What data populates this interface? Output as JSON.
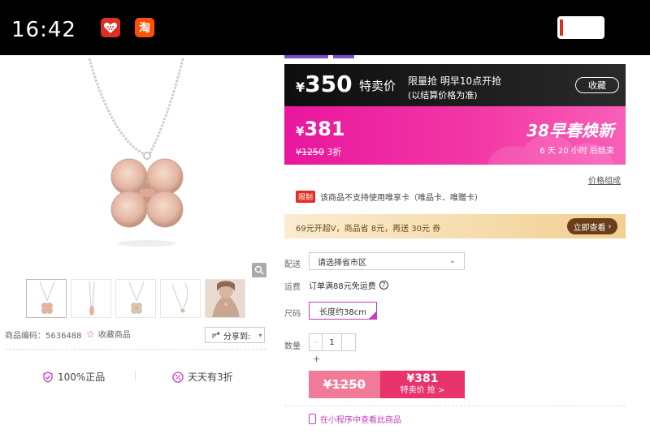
{
  "status_bar": {
    "time": "16:42",
    "apps": [
      {
        "name": "pinduoduo",
        "glyph": "",
        "color": "#e02e24"
      },
      {
        "name": "taobao",
        "glyph": "淘",
        "color": "#ff5000"
      }
    ],
    "battery_level": 0.08
  },
  "product_gallery": {
    "thumbnail_count": 5,
    "item_code": "商品编码：5636488",
    "favorite_label": "收藏商品",
    "share_label": "分享到:"
  },
  "guarantees": [
    {
      "label": "100%正品",
      "icon": "shield-check-icon"
    },
    {
      "label": "天天有3折",
      "icon": "discount-icon"
    }
  ],
  "flash_sale": {
    "price": "350",
    "currency": "¥",
    "label": "特卖价",
    "info_line1": "限量抢  明早10点开抢",
    "info_line2": "(以结算价格为准)",
    "collect_label": "收藏"
  },
  "promo": {
    "currency": "¥",
    "price": "381",
    "original_price": "¥1250",
    "discount": "3折",
    "event_title": "38早春焕新",
    "countdown": "6 天 20 小时 后结束"
  },
  "price_detail_link": "价格组成",
  "limit_notice": {
    "badge": "限制",
    "text": "该商品不支持使用唯享卡（唯品卡、唯赠卡）"
  },
  "vip_banner": {
    "text": "69元开超V，商品省 8元，再送 30元 券",
    "button_label": "立即查看"
  },
  "options": {
    "delivery_label": "配送",
    "delivery_placeholder": "请选择省市区",
    "shipping_label": "运费",
    "shipping_text": "订单满88元免运费",
    "size_label": "尺码",
    "size_value": "长度约38cm",
    "quantity_label": "数量",
    "quantity_value": "1",
    "minus": "-",
    "plus": "+"
  },
  "buy_bar": {
    "original_price": "¥1250",
    "price": "¥381",
    "action_label": "特卖价 抢 >"
  },
  "mini_program_link": "在小程序中查看此商品",
  "colors": {
    "accent": "#c03fbf",
    "promo_pink": "#e8169d",
    "buy_pink": "#e8336d",
    "flash_black": "#0e0e0e"
  }
}
